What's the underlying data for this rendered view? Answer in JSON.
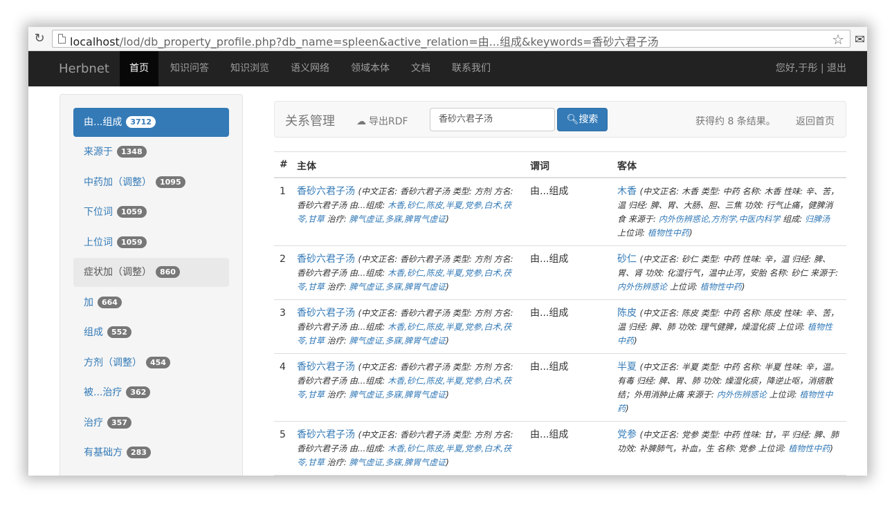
{
  "browser": {
    "url_host": "localhost",
    "url_rest": "/lod/db_property_profile.php?db_name=spleen&active_relation=由...组成&keywords=香砂六君子汤"
  },
  "navbar": {
    "brand": "Herbnet",
    "items": [
      "首页",
      "知识问答",
      "知识浏览",
      "语义网络",
      "领域本体",
      "文档",
      "联系我们"
    ],
    "user_text": "您好,于彤 | 退出"
  },
  "sidebar": {
    "items": [
      {
        "label": "由...组成",
        "count": "3712"
      },
      {
        "label": "来源于",
        "count": "1348"
      },
      {
        "label": "中药加（调整）",
        "count": "1095"
      },
      {
        "label": "下位词",
        "count": "1059"
      },
      {
        "label": "上位词",
        "count": "1059"
      },
      {
        "label": "症状加（调整）",
        "count": "860"
      },
      {
        "label": "加",
        "count": "664"
      },
      {
        "label": "组成",
        "count": "552"
      },
      {
        "label": "方剂（调整）",
        "count": "454"
      },
      {
        "label": "被...治疗",
        "count": "362"
      },
      {
        "label": "治疗",
        "count": "357"
      },
      {
        "label": "有基础方",
        "count": "283"
      }
    ]
  },
  "panel": {
    "title": "关系管理",
    "export_label": "导出RDF",
    "keyword_value": "香砂六君子汤",
    "search_label": "搜索",
    "result_text": "获得约 8 条结果。",
    "back_label": "返回首页"
  },
  "table": {
    "headers": {
      "num": "#",
      "subject": "主体",
      "predicate": "谓词",
      "object": "客体"
    },
    "subject_common": {
      "name": "香砂六君子汤",
      "meta_a": "(中文正名: 香砂六君子汤 类型: 方剂 方名: 香砂六君子汤 由...组成: ",
      "components": "木香,砂仁,陈皮,半夏,党参,白术,茯苓,甘草",
      "meta_b": " 治疗: ",
      "treats": "脾气虚证,多寐,脾胃气虚证",
      "meta_c": ")"
    },
    "rows": [
      {
        "num": "1",
        "predicate": "由...组成",
        "object_name": "木香",
        "object_meta_a": "(中文正名: 木香 类型: 中药 名称: 木香 性味: 辛、苦，温 归经: 脾、胃、大肠、胆、三焦 功效: 行气止痛，健脾消食 来源于: ",
        "object_link_a": "内外伤辨惑论,方剂学,中医内科学",
        "object_meta_b": " 组成: ",
        "object_link_b": "归脾汤",
        "object_meta_c": " 上位词: ",
        "object_link_c": "植物性中药",
        "object_meta_d": ")"
      },
      {
        "num": "2",
        "predicate": "由...组成",
        "object_name": "砂仁",
        "object_meta_a": "(中文正名: 砂仁 类型: 中药 性味: 辛，温 归经: 脾、胃、肾 功效: 化湿行气，温中止泻，安胎 名称: 砂仁 来源于: ",
        "object_link_a": "内外伤辨惑论",
        "object_meta_b": " 上位词: ",
        "object_link_b": "植物性中药",
        "object_meta_c": ")",
        "object_link_c": "",
        "object_meta_d": ""
      },
      {
        "num": "3",
        "predicate": "由...组成",
        "object_name": "陈皮",
        "object_meta_a": "(中文正名: 陈皮 类型: 中药 名称: 陈皮 性味: 辛、苦，温 归经: 脾、肺 功效: 理气健脾，燥湿化痰 上位词: ",
        "object_link_a": "植物性中药",
        "object_meta_b": ")",
        "object_link_b": "",
        "object_meta_c": "",
        "object_link_c": "",
        "object_meta_d": ""
      },
      {
        "num": "4",
        "predicate": "由...组成",
        "object_name": "半夏",
        "object_meta_a": "(中文正名: 半夏 类型: 中药 名称: 半夏 性味: 辛，温。有毒 归经: 脾、胃、肺 功效: 燥湿化痰，降逆止呕，消痞散结；外用消肿止痛 来源于: ",
        "object_link_a": "内外伤辨惑论",
        "object_meta_b": " 上位词: ",
        "object_link_b": "植物性中药",
        "object_meta_c": ")",
        "object_link_c": "",
        "object_meta_d": ""
      },
      {
        "num": "5",
        "predicate": "由...组成",
        "object_name": "党参",
        "object_meta_a": "(中文正名: 党参 类型: 中药 性味: 甘，平 归经: 脾、肺 功效: 补脾肺气，补血，生 名称: 党参 上位词: ",
        "object_link_a": "植物性中药",
        "object_meta_b": ")",
        "object_link_b": "",
        "object_meta_c": "",
        "object_link_c": "",
        "object_meta_d": ""
      }
    ]
  }
}
